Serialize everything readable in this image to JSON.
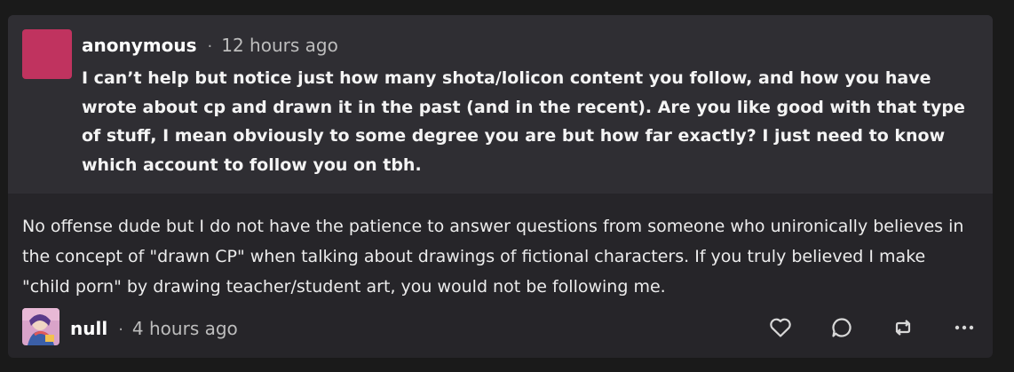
{
  "colors": {
    "ask_avatar": "#c0335f",
    "card_bg": "#262529",
    "ask_bg": "#2f2e33",
    "icon": "#d8d8d8"
  },
  "ask": {
    "author": "anonymous",
    "separator": "·",
    "time": "12 hours ago",
    "text": "I can’t help but notice just how many shota/lolicon content you follow, and how you have wrote about cp and drawn it in the past (and in the recent). Are you like good with that type of stuff, I mean obviously to some degree you are but how far exactly? I just need to know which account to follow you on tbh."
  },
  "answer": {
    "text": "No offense dude but I do not have the patience to answer questions from someone who unironically believes in the concept of \"drawn CP\" when talking about drawings of fictional characters. If you truly believed I make \"child porn\" by drawing teacher/student art, you would not be following me.",
    "author": "null",
    "separator": "·",
    "time": "4 hours ago"
  },
  "actions": [
    {
      "icon": "heart-icon"
    },
    {
      "icon": "reply-icon"
    },
    {
      "icon": "repost-icon"
    },
    {
      "icon": "more-icon"
    }
  ]
}
